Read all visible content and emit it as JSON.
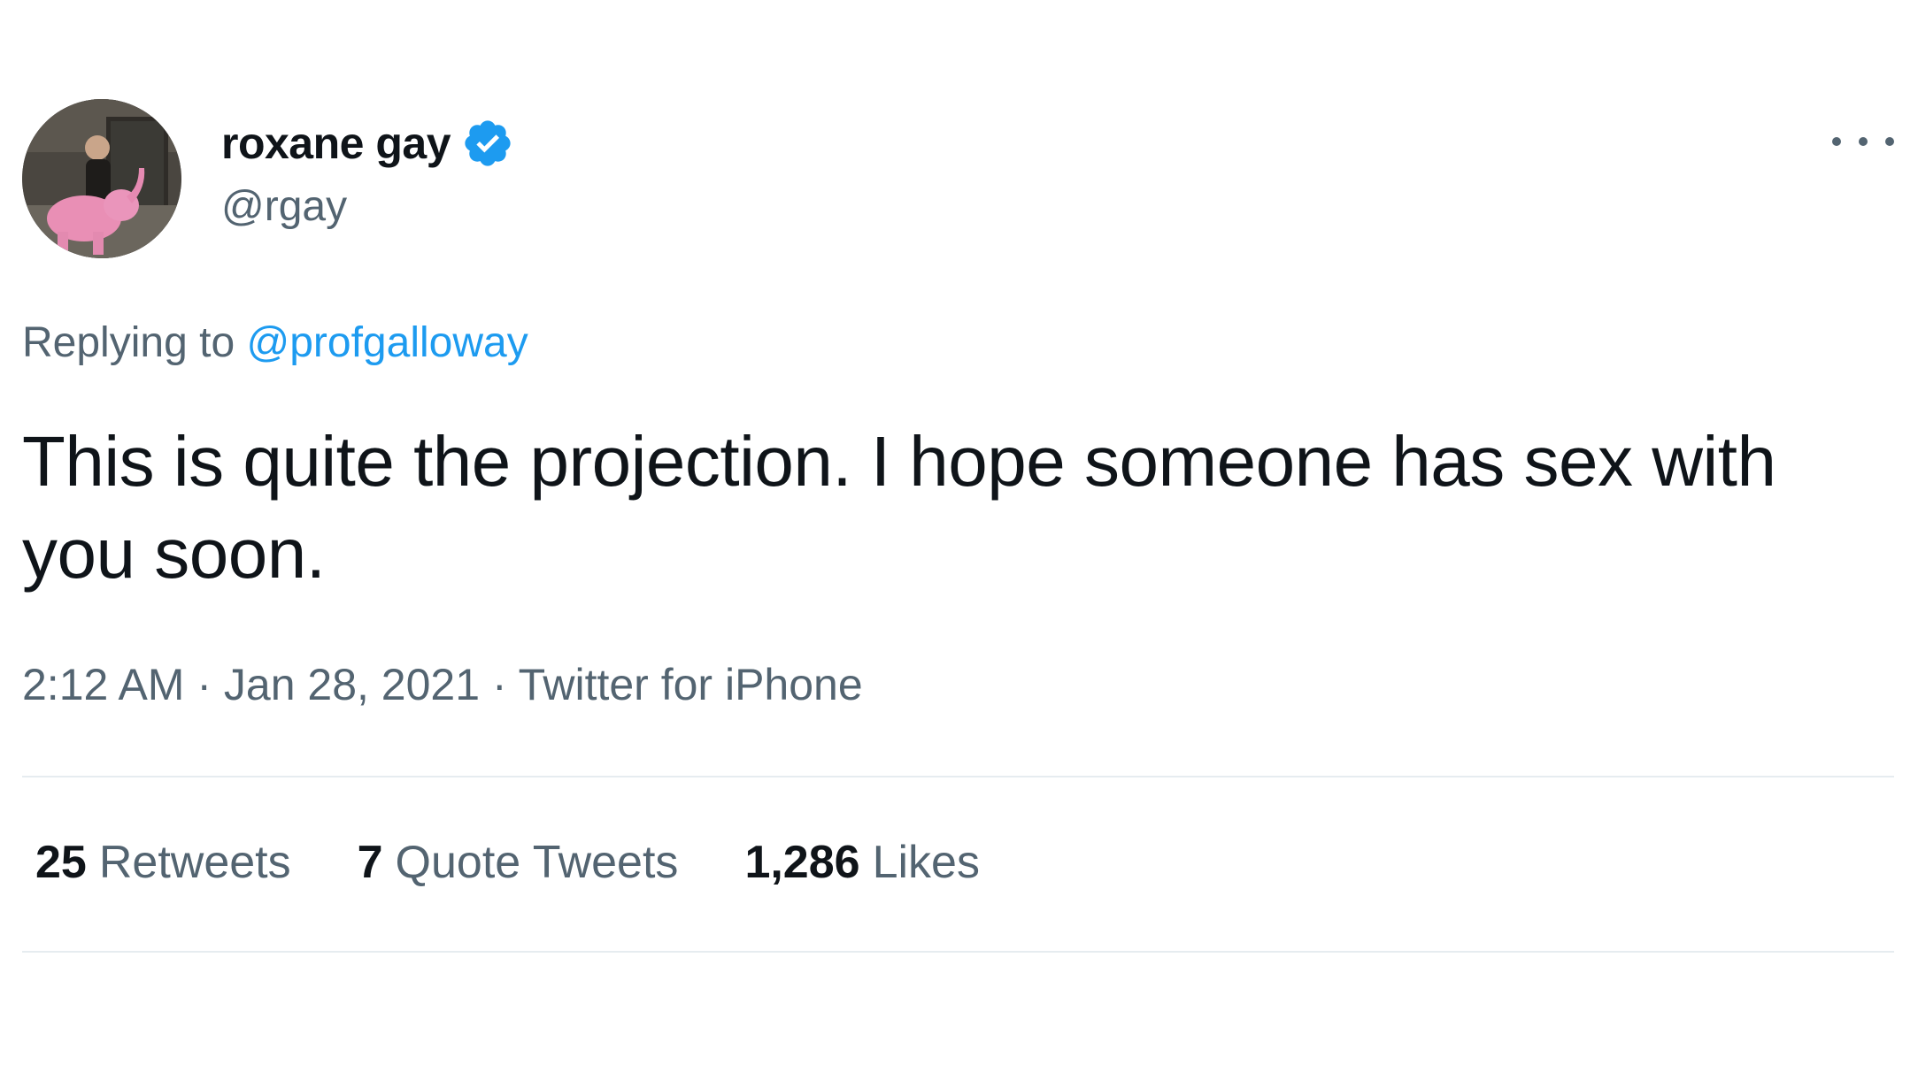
{
  "author": {
    "display_name": "roxane gay",
    "handle": "@rgay",
    "verified_icon": "verified-badge-icon",
    "avatar_icon": "avatar-photo"
  },
  "more_icon": "more-options-icon",
  "reply": {
    "prefix": "Replying to",
    "target": "@profgalloway"
  },
  "tweet": {
    "text": "This is quite the projection. I hope someone has sex with you soon."
  },
  "meta": {
    "time": "2:12 AM",
    "separator": "·",
    "date": "Jan 28, 2021",
    "source": "Twitter for iPhone"
  },
  "stats": {
    "retweets_count": "25",
    "retweets_label": "Retweets",
    "quotes_count": "7",
    "quotes_label": "Quote Tweets",
    "likes_count": "1,286",
    "likes_label": "Likes"
  },
  "colors": {
    "text_primary": "#0f1419",
    "text_secondary": "#536471",
    "accent": "#1d9bf0",
    "divider": "#e6ecf0"
  }
}
